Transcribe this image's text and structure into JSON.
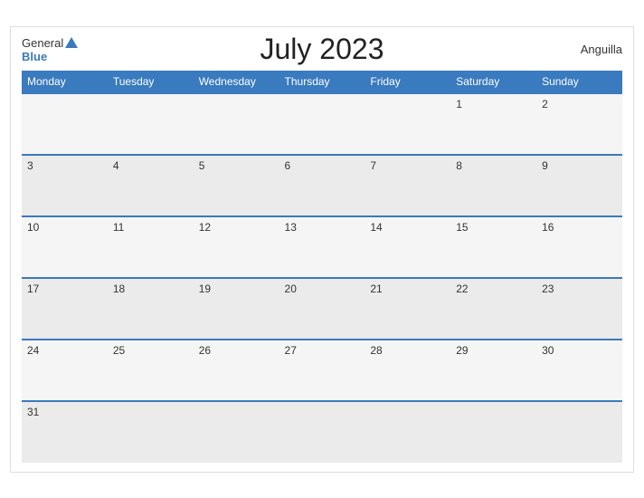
{
  "header": {
    "title": "July 2023",
    "country": "Anguilla",
    "logo_general": "General",
    "logo_blue": "Blue"
  },
  "weekdays": [
    "Monday",
    "Tuesday",
    "Wednesday",
    "Thursday",
    "Friday",
    "Saturday",
    "Sunday"
  ],
  "weeks": [
    [
      null,
      null,
      null,
      null,
      null,
      1,
      2
    ],
    [
      3,
      4,
      5,
      6,
      7,
      8,
      9
    ],
    [
      10,
      11,
      12,
      13,
      14,
      15,
      16
    ],
    [
      17,
      18,
      19,
      20,
      21,
      22,
      23
    ],
    [
      24,
      25,
      26,
      27,
      28,
      29,
      30
    ],
    [
      31,
      null,
      null,
      null,
      null,
      null,
      null
    ]
  ]
}
